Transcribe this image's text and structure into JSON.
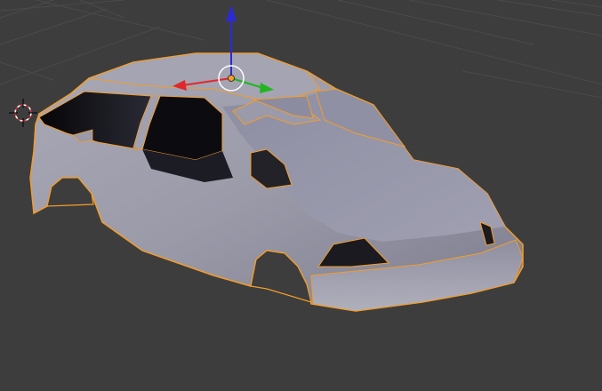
{
  "viewport": {
    "background_color": "#3d3d3d",
    "grid_color": "#4a4a4a",
    "selection_outline_color": "#f39c2a",
    "mesh_color": "#9c9cac",
    "interior_color": "#0e0e12"
  },
  "gizmo": {
    "x_axis_color": "#e0282c",
    "y_axis_color": "#22b522",
    "z_axis_color": "#2a2ad6",
    "pivot_color": "#f39c2a",
    "ring_color": "#ffffff"
  },
  "cursor_3d": {
    "colors": [
      "#ffffff",
      "#e0282c"
    ]
  },
  "icons": {
    "transform_gizmo": "transform-manipulator-icon",
    "cursor": "3d-cursor-icon",
    "pivot": "object-origin-icon"
  }
}
